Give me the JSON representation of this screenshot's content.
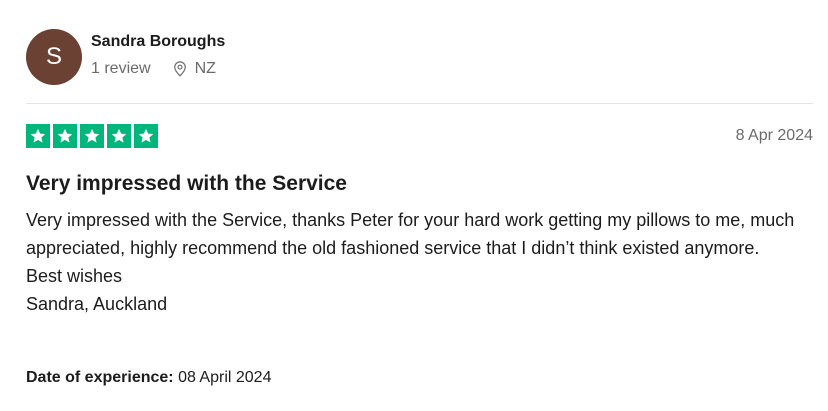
{
  "reviewer": {
    "initial": "S",
    "name": "Sandra Boroughs",
    "review_count": "1 review",
    "country": "NZ",
    "avatar_color": "#6b4133"
  },
  "review": {
    "rating": 5,
    "rating_max": 5,
    "star_color": "#00b67a",
    "date": "8 Apr 2024",
    "title": "Very impressed with the Service",
    "body_paragraph": "Very impressed with the Service, thanks Peter for your hard work getting my pillows to me, much appreciated, highly recommend the old fashioned service that I didn’t think existed anymore.",
    "body_closing": "Best wishes",
    "body_signature": "Sandra, Auckland",
    "experience_label": "Date of experience:",
    "experience_date": "08 April 2024"
  },
  "icons": {
    "location": "location-pin-icon",
    "star": "star-icon"
  }
}
